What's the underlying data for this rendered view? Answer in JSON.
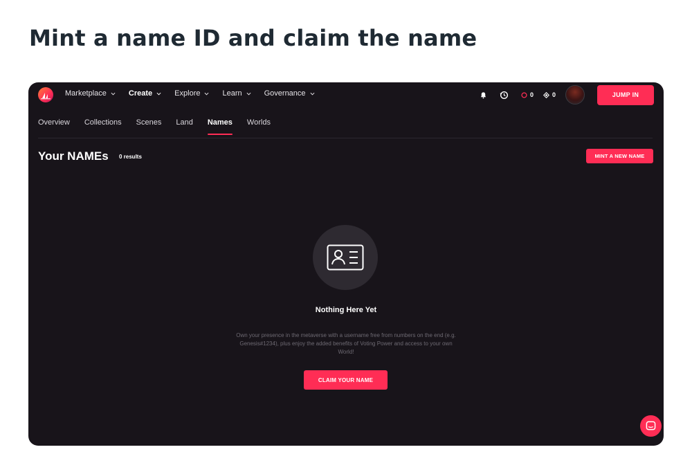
{
  "page": {
    "heading": "Mint a name ID and claim the name"
  },
  "topnav": {
    "menu": [
      {
        "label": "Marketplace",
        "bold": false
      },
      {
        "label": "Create",
        "bold": true
      },
      {
        "label": "Explore",
        "bold": false
      },
      {
        "label": "Learn",
        "bold": false
      },
      {
        "label": "Governance",
        "bold": false
      }
    ],
    "mana_count": "0",
    "polygon_count": "0",
    "jump_in_label": "JUMP IN"
  },
  "subnav": {
    "tabs": [
      "Overview",
      "Collections",
      "Scenes",
      "Land",
      "Names",
      "Worlds"
    ],
    "active": "Names"
  },
  "section": {
    "title": "Your NAMEs",
    "results": "0 results",
    "mint_label": "MINT A NEW NAME"
  },
  "empty_state": {
    "icon": "id-card-icon",
    "title": "Nothing Here Yet",
    "description": "Own your presence in the metaverse with a username free from numbers on the end (e.g. Genesis#1234), plus enjoy the added benefits of Voting Power and access to your own World!",
    "claim_label": "CLAIM YOUR NAME"
  },
  "colors": {
    "accent": "#ff2d55",
    "background": "#18141a",
    "heading": "#1f2a33"
  }
}
